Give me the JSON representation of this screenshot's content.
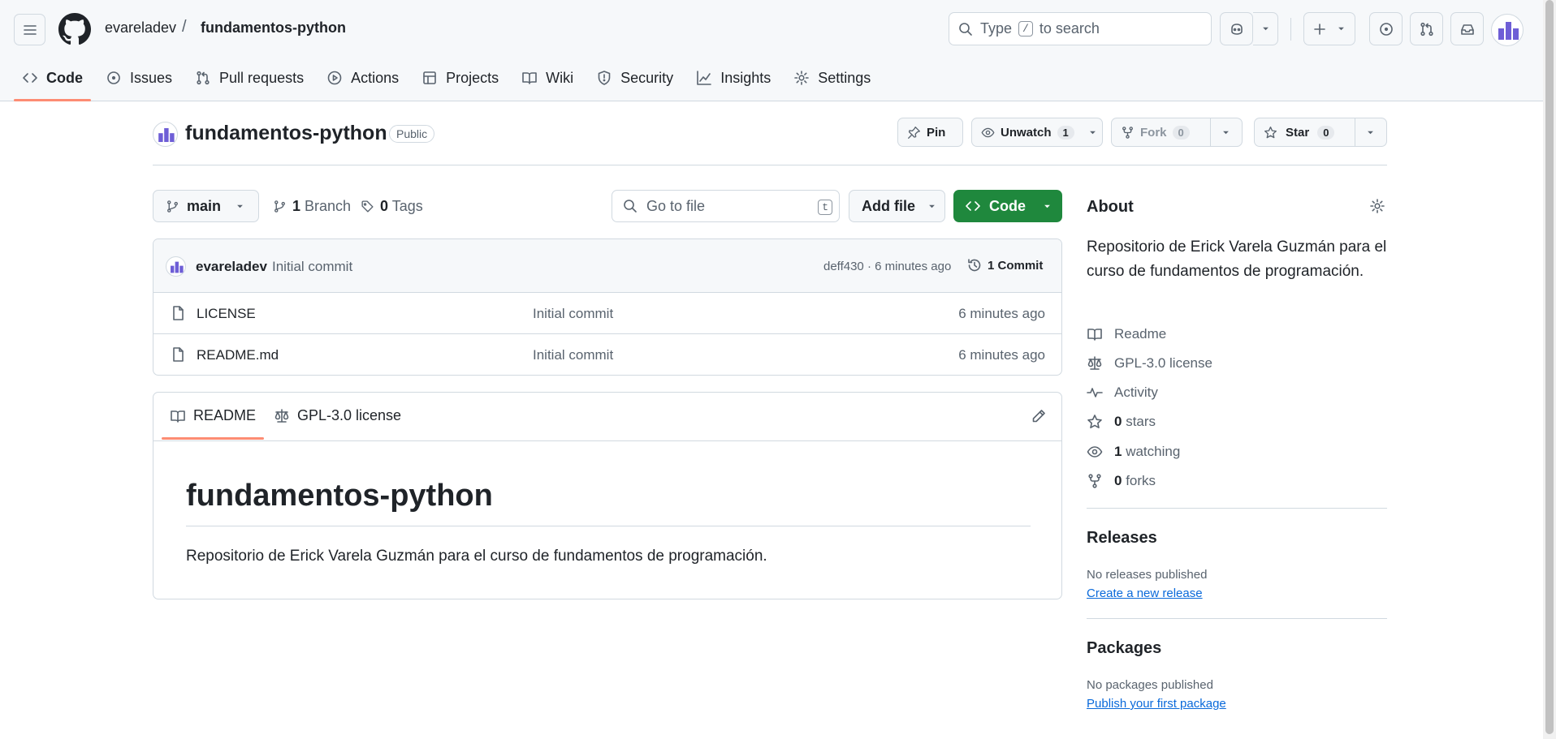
{
  "header": {
    "owner": "evareladev",
    "separator": "/",
    "repo": "fundamentos-python",
    "search_prefix": "Type",
    "search_key": "/",
    "search_suffix": "to search"
  },
  "nav": {
    "tabs": [
      {
        "label": "Code",
        "icon": "code-icon",
        "active": true
      },
      {
        "label": "Issues",
        "icon": "issue-icon"
      },
      {
        "label": "Pull requests",
        "icon": "pull-request-icon"
      },
      {
        "label": "Actions",
        "icon": "play-icon"
      },
      {
        "label": "Projects",
        "icon": "table-icon"
      },
      {
        "label": "Wiki",
        "icon": "book-icon"
      },
      {
        "label": "Security",
        "icon": "shield-icon"
      },
      {
        "label": "Insights",
        "icon": "graph-icon"
      },
      {
        "label": "Settings",
        "icon": "gear-icon"
      }
    ]
  },
  "repo": {
    "title": "fundamentos-python",
    "visibility": "Public",
    "pin_label": "Pin",
    "unwatch_label": "Unwatch",
    "watch_count": "1",
    "fork_label": "Fork",
    "fork_count": "0",
    "star_label": "Star",
    "star_count": "0"
  },
  "toolbar": {
    "branch": "main",
    "branch_count": "1",
    "branch_label": "Branch",
    "tag_count": "0",
    "tag_label": "Tags",
    "goto_placeholder": "Go to file",
    "goto_key": "t",
    "add_file": "Add file",
    "code": "Code"
  },
  "commit": {
    "author": "evareladev",
    "message": "Initial commit",
    "meta": "deff430 · 6 minutes ago",
    "count_label": "1 Commit"
  },
  "files": [
    {
      "name": "LICENSE",
      "commit": "Initial commit",
      "age": "6 minutes ago"
    },
    {
      "name": "README.md",
      "commit": "Initial commit",
      "age": "6 minutes ago"
    }
  ],
  "readme": {
    "tab_readme": "README",
    "tab_license": "GPL-3.0 license",
    "heading": "fundamentos-python",
    "body": "Repositorio de Erick Varela Guzmán para el curso de fundamentos de programación."
  },
  "about": {
    "heading": "About",
    "description": "Repositorio de Erick Varela Guzmán para el curso de fundamentos de programación.",
    "readme": "Readme",
    "license": "GPL-3.0 license",
    "activity": "Activity",
    "stars_count": "0",
    "stars_label": "stars",
    "watching_count": "1",
    "watching_label": "watching",
    "forks_count": "0",
    "forks_label": "forks"
  },
  "releases": {
    "heading": "Releases",
    "note": "No releases published",
    "link": "Create a new release"
  },
  "packages": {
    "heading": "Packages",
    "note": "No packages published",
    "link": "Publish your first package"
  },
  "colors": {
    "accent_underline": "#fd8c73",
    "code_button": "#1f883d",
    "link": "#0969da"
  }
}
